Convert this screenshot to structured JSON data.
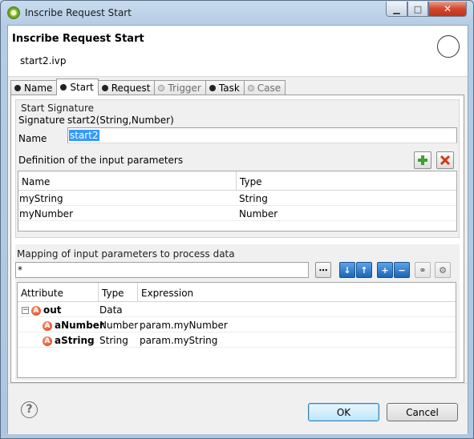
{
  "window": {
    "title": "Inscribe Request Start"
  },
  "header": {
    "title": "Inscribe Request Start",
    "subtitle": "start2.ivp"
  },
  "tabs": [
    {
      "label": "Name",
      "active": false,
      "enabled": true
    },
    {
      "label": "Start",
      "active": true,
      "enabled": true
    },
    {
      "label": "Request",
      "active": false,
      "enabled": true
    },
    {
      "label": "Trigger",
      "active": false,
      "enabled": false
    },
    {
      "label": "Task",
      "active": false,
      "enabled": true
    },
    {
      "label": "Case",
      "active": false,
      "enabled": false
    }
  ],
  "start_signature": {
    "group_label": "Start Signature",
    "signature_label": "Signature",
    "signature_value": "start2(String,Number)",
    "name_label": "Name",
    "name_value": "start2"
  },
  "input_params": {
    "label": "Definition of the input parameters",
    "columns": [
      "Name",
      "Type"
    ],
    "rows": [
      {
        "name": "myString",
        "type": "String"
      },
      {
        "name": "myNumber",
        "type": "Number"
      }
    ]
  },
  "mapping": {
    "label": "Mapping of input parameters to process data",
    "filter_value": "*",
    "columns": [
      "Attribute",
      "Type",
      "Expression"
    ],
    "rows": [
      {
        "attribute": "out",
        "type": "Data",
        "expression": "",
        "icon": "attribute-icon",
        "expanded": true
      },
      {
        "attribute": "aNumber",
        "type": "Number",
        "expression": "param.myNumber",
        "icon": "attribute-icon"
      },
      {
        "attribute": "aString",
        "type": "String",
        "expression": "param.myString",
        "icon": "attribute-icon"
      }
    ]
  },
  "footer": {
    "help_icon": "help-icon",
    "ok_label": "OK",
    "cancel_label": "Cancel"
  },
  "colors": {
    "selection": "#3399ff",
    "add_green": "#3aa32b",
    "delete_red": "#d23a10"
  }
}
